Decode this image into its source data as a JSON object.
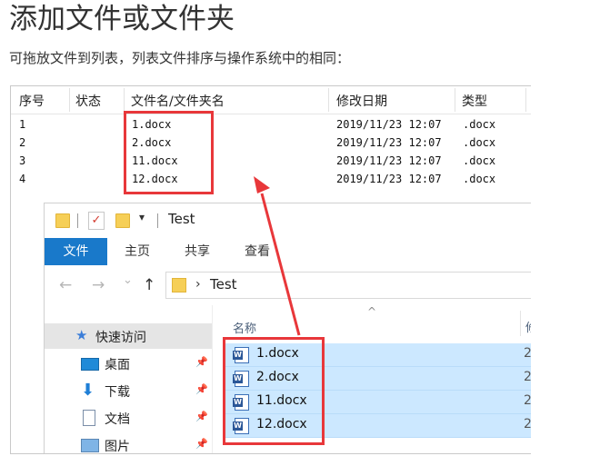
{
  "page": {
    "title": "添加文件或文件夹",
    "description": "可拖放文件到列表，列表文件排序与操作系统中的相同："
  },
  "list": {
    "columns": [
      "序号",
      "状态",
      "文件名/文件夹名",
      "修改日期",
      "类型"
    ],
    "rows": [
      {
        "index": "1",
        "name": "1.docx",
        "date": "2019/11/23 12:07",
        "type": ".docx"
      },
      {
        "index": "2",
        "name": "2.docx",
        "date": "2019/11/23 12:07",
        "type": ".docx"
      },
      {
        "index": "3",
        "name": "11.docx",
        "date": "2019/11/23 12:07",
        "type": ".docx"
      },
      {
        "index": "4",
        "name": "12.docx",
        "date": "2019/11/23 12:07",
        "type": ".docx"
      }
    ]
  },
  "explorer": {
    "window_title": "Test",
    "quick_access_dropdown": "▾",
    "ribbon_tabs": [
      "文件",
      "主页",
      "共享",
      "查看"
    ],
    "nav_buttons": {
      "back": "←",
      "forward": "→",
      "recent": "⌄",
      "up": "↑"
    },
    "address": {
      "chevron": "›",
      "path": "Test"
    },
    "nav_pane": [
      {
        "label": "快速访问",
        "icon": "star-icon"
      },
      {
        "label": "桌面",
        "icon": "desktop-icon",
        "pinned": true
      },
      {
        "label": "下载",
        "icon": "download-icon",
        "pinned": true
      },
      {
        "label": "文档",
        "icon": "document-icon",
        "pinned": true
      },
      {
        "label": "图片",
        "icon": "picture-icon",
        "pinned": true
      }
    ],
    "pin_glyph": "📌",
    "column_header": {
      "name": "名称",
      "sort_caret": "^",
      "truncated": "修"
    },
    "files": [
      {
        "name": "1.docx",
        "trunc": "2"
      },
      {
        "name": "2.docx",
        "trunc": "2"
      },
      {
        "name": "11.docx",
        "trunc": "2"
      },
      {
        "name": "12.docx",
        "trunc": "2"
      }
    ],
    "word_badge": "W"
  },
  "colors": {
    "accent_tab": "#1979ca",
    "selection": "#cce8ff",
    "highlight": "#e8373a"
  }
}
